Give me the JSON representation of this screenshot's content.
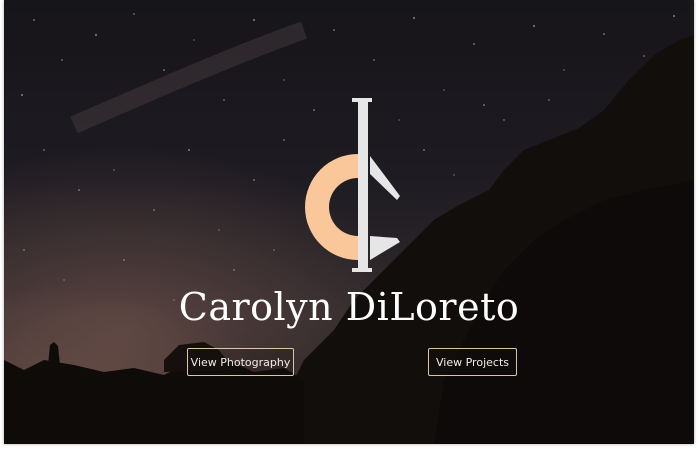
{
  "hero": {
    "name": "Carolyn DiLoreto",
    "buttons": {
      "photography": "View Photography",
      "projects": "View Projects"
    }
  },
  "logo": {
    "icon": "cd-monogram-icon",
    "accent_color": "#f9c79a",
    "secondary_color": "#e6e6e6"
  },
  "colors": {
    "button_border": "#d8c7a8",
    "text": "#ffffff"
  }
}
